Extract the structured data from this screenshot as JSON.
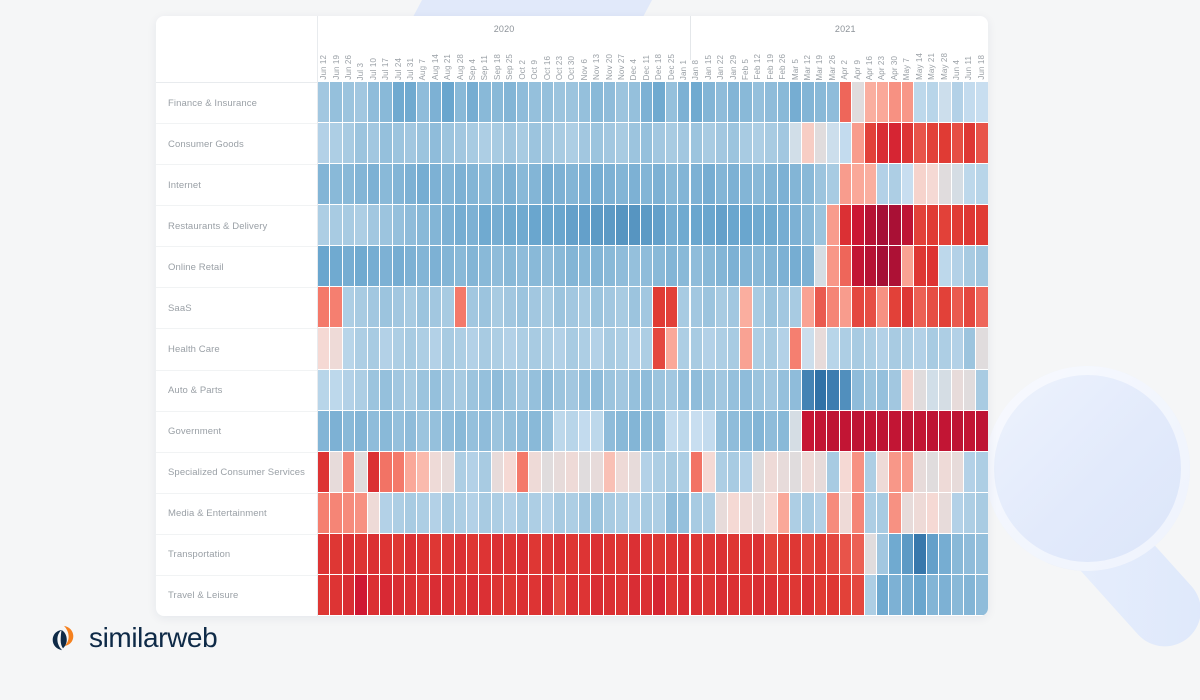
{
  "brand": {
    "name": "similarweb",
    "navy": "#0e2a47",
    "orange": "#f5811f"
  },
  "chart_data": {
    "type": "heatmap",
    "title": "",
    "xlabel": "",
    "ylabel": "",
    "legend_position": "none",
    "grid": false,
    "colorscale": {
      "name": "RdBu reversed (blue = below baseline / decline, red = above baseline / growth)",
      "stops": [
        {
          "value": -3,
          "color": "#2b6ca3"
        },
        {
          "value": -2,
          "color": "#6aa6ce"
        },
        {
          "value": -1,
          "color": "#a8cbe2"
        },
        {
          "value": -0.4,
          "color": "#c8def0"
        },
        {
          "value": 0,
          "color": "#d9dde0"
        },
        {
          "value": 0.4,
          "color": "#f5d9d4"
        },
        {
          "value": 1,
          "color": "#fbb4a5"
        },
        {
          "value": 2,
          "color": "#f4796a"
        },
        {
          "value": 3,
          "color": "#e03b34"
        },
        {
          "value": 4,
          "color": "#cf1733"
        },
        {
          "value": 5,
          "color": "#a50f35"
        }
      ]
    },
    "year_bands": [
      {
        "label": "2020",
        "start_index": 0,
        "end_index": 29
      },
      {
        "label": "2021",
        "start_index": 30,
        "end_index": 54
      }
    ],
    "x": [
      "Jun 12",
      "Jun 19",
      "Jun 26",
      "Jul 3",
      "Jul 10",
      "Jul 17",
      "Jul 24",
      "Jul 31",
      "Aug 7",
      "Aug 14",
      "Aug 21",
      "Aug 28",
      "Sep 4",
      "Sep 11",
      "Sep 18",
      "Sep 25",
      "Oct 2",
      "Oct 9",
      "Oct 16",
      "Oct 23",
      "Oct 30",
      "Nov 6",
      "Nov 13",
      "Nov 20",
      "Nov 27",
      "Dec 4",
      "Dec 11",
      "Dec 18",
      "Dec 25",
      "Jan 1",
      "Jan 8",
      "Jan 15",
      "Jan 22",
      "Jan 29",
      "Feb 5",
      "Feb 12",
      "Feb 19",
      "Feb 26",
      "Mar 5",
      "Mar 12",
      "Mar 19",
      "Mar 26",
      "Apr 2",
      "Apr 9",
      "Apr 16",
      "Apr 23",
      "Apr 30",
      "May 7",
      "May 14",
      "May 21",
      "May 28",
      "Jun 4",
      "Jun 11",
      "Jun 18"
    ],
    "y": [
      "Finance & Insurance",
      "Consumer Goods",
      "Internet",
      "Restaurants & Delivery",
      "Online Retail",
      "SaaS",
      "Health Care",
      "Auto & Parts",
      "Government",
      "Specialized Consumer Services",
      "Media & Entertainment",
      "Transportation",
      "Travel & Leisure"
    ],
    "series": [
      {
        "name": "Finance & Insurance",
        "values": [
          -1.1,
          -1.3,
          -1.2,
          -1.1,
          -1.4,
          -1.5,
          -1.9,
          -1.9,
          -1.4,
          -1.7,
          -2.0,
          -1.5,
          -1.8,
          -1.5,
          -1.5,
          -1.6,
          -1.4,
          -1.3,
          -1.3,
          -1.2,
          -1.2,
          -1.3,
          -1.5,
          -1.4,
          -1.2,
          -1.3,
          -1.7,
          -1.9,
          -1.3,
          -1.7,
          -1.9,
          -1.6,
          -1.4,
          -1.6,
          -1.5,
          -1.3,
          -1.4,
          -1.5,
          -1.8,
          -1.6,
          -1.5,
          -1.4,
          2.3,
          0.1,
          1.1,
          1.2,
          1.6,
          1.5,
          -0.6,
          -0.7,
          -0.3,
          -0.8,
          -0.5,
          -0.4
        ]
      },
      {
        "name": "Consumer Goods",
        "values": [
          -0.8,
          -0.9,
          -1.0,
          -1.2,
          -1.1,
          -1.3,
          -1.2,
          -1.1,
          -1.2,
          -1.4,
          -1.2,
          -1.1,
          -1.0,
          -0.9,
          -1.0,
          -1.1,
          -1.0,
          -1.2,
          -1.1,
          -1.0,
          -0.9,
          -1.1,
          -1.2,
          -1.1,
          -1.0,
          -1.2,
          -1.3,
          -1.1,
          -1.0,
          -1.1,
          -1.2,
          -1.0,
          -1.1,
          -1.2,
          -1.0,
          -0.9,
          -1.0,
          -1.1,
          -0.2,
          0.6,
          0.1,
          -0.3,
          -0.5,
          1.4,
          2.9,
          3.4,
          3.6,
          3.2,
          2.6,
          2.9,
          3.0,
          2.7,
          3.1,
          2.6
        ]
      },
      {
        "name": "Internet",
        "values": [
          -1.6,
          -1.5,
          -1.5,
          -1.6,
          -1.7,
          -1.5,
          -1.6,
          -1.7,
          -1.8,
          -1.7,
          -1.6,
          -1.7,
          -1.6,
          -1.5,
          -1.6,
          -1.7,
          -1.5,
          -1.6,
          -1.8,
          -1.7,
          -1.6,
          -1.7,
          -1.8,
          -1.7,
          -1.6,
          -1.7,
          -1.6,
          -1.7,
          -1.5,
          -1.6,
          -1.7,
          -1.8,
          -1.6,
          -1.7,
          -1.6,
          -1.5,
          -1.6,
          -1.7,
          -1.6,
          -1.5,
          -1.2,
          -1.0,
          1.4,
          1.2,
          1.1,
          -0.8,
          -0.9,
          -0.4,
          0.5,
          0.4,
          0.1,
          -0.1,
          -0.6,
          -0.7
        ]
      },
      {
        "name": "Restaurants & Delivery",
        "values": [
          -0.9,
          -1.0,
          -1.0,
          -0.9,
          -1.1,
          -1.2,
          -1.3,
          -1.4,
          -1.5,
          -1.6,
          -1.7,
          -1.8,
          -1.7,
          -1.9,
          -1.8,
          -1.9,
          -1.9,
          -2.0,
          -2.0,
          -2.0,
          -2.1,
          -2.1,
          -2.2,
          -2.2,
          -2.3,
          -2.3,
          -2.2,
          -2.1,
          -1.8,
          -1.9,
          -2.0,
          -2.0,
          -2.1,
          -2.0,
          -2.0,
          -1.9,
          -1.9,
          -1.8,
          -1.7,
          -1.5,
          -1.2,
          1.4,
          3.3,
          4.1,
          4.6,
          5.0,
          4.9,
          4.4,
          2.9,
          3.0,
          2.9,
          3.0,
          3.1,
          3.0
        ]
      },
      {
        "name": "Online Retail",
        "values": [
          -2.0,
          -1.9,
          -1.8,
          -1.9,
          -1.8,
          -1.7,
          -1.8,
          -1.7,
          -1.6,
          -1.7,
          -1.6,
          -1.5,
          -1.6,
          -1.5,
          -1.4,
          -1.5,
          -1.4,
          -1.5,
          -1.4,
          -1.5,
          -1.6,
          -1.5,
          -1.6,
          -1.5,
          -1.4,
          -1.3,
          -1.4,
          -1.5,
          -1.6,
          -1.5,
          -1.4,
          -1.5,
          -1.6,
          -1.7,
          -1.6,
          -1.5,
          -1.6,
          -1.7,
          -1.8,
          -1.7,
          -0.1,
          1.5,
          2.3,
          4.3,
          4.6,
          5.0,
          4.8,
          1.3,
          3.1,
          3.2,
          -0.6,
          -0.8,
          -1.0,
          -1.1
        ]
      },
      {
        "name": "SaaS",
        "values": [
          2.0,
          1.9,
          -0.9,
          -1.0,
          -1.1,
          -1.2,
          -1.1,
          -1.0,
          -1.2,
          -1.1,
          -1.0,
          2.0,
          -1.1,
          -1.2,
          -1.0,
          -1.1,
          -1.2,
          -1.1,
          -1.0,
          -1.2,
          -1.1,
          -1.0,
          -1.2,
          -1.1,
          -1.0,
          -1.2,
          -1.1,
          3.0,
          2.9,
          -1.0,
          -1.1,
          -1.2,
          -1.0,
          -1.1,
          1.1,
          -1.0,
          -1.2,
          -1.1,
          -1.0,
          1.3,
          2.5,
          1.8,
          1.4,
          2.8,
          2.7,
          1.6,
          2.9,
          3.1,
          2.4,
          2.7,
          2.9,
          2.5,
          2.8,
          2.3
        ]
      },
      {
        "name": "Health Care",
        "values": [
          0.4,
          0.3,
          -0.7,
          -0.9,
          -1.0,
          -0.8,
          -0.9,
          -1.0,
          -0.9,
          -0.8,
          -1.0,
          -0.9,
          -0.8,
          -1.0,
          -0.9,
          -0.8,
          -0.9,
          -1.0,
          -0.9,
          -0.8,
          -1.0,
          -0.9,
          -0.8,
          -1.0,
          -0.9,
          -0.8,
          -0.9,
          2.8,
          1.2,
          -0.9,
          -1.0,
          -0.8,
          -0.9,
          -1.0,
          1.3,
          -0.9,
          -1.0,
          -0.8,
          1.9,
          -0.3,
          0.2,
          -0.7,
          -0.9,
          -1.0,
          -0.9,
          -0.8,
          -1.0,
          -0.9,
          -0.8,
          -1.0,
          -0.9,
          -0.8,
          -1.2,
          0.1
        ]
      },
      {
        "name": "Auto & Parts",
        "values": [
          -0.7,
          -0.6,
          -0.8,
          -0.9,
          -1.2,
          -1.3,
          -1.1,
          -1.0,
          -1.2,
          -1.3,
          -1.1,
          -1.0,
          -1.2,
          -1.3,
          -1.4,
          -1.2,
          -1.1,
          -1.3,
          -1.4,
          -1.2,
          -1.1,
          -1.3,
          -1.4,
          -1.2,
          -1.1,
          -1.3,
          -1.4,
          -1.2,
          -1.1,
          -1.3,
          -1.4,
          -1.2,
          -1.1,
          -1.3,
          -1.4,
          -1.2,
          -1.1,
          -1.3,
          -1.4,
          -2.6,
          -2.9,
          -2.7,
          -2.4,
          -1.4,
          -1.2,
          -1.3,
          -1.1,
          0.5,
          0.1,
          -0.2,
          -0.1,
          0.2,
          0.1,
          -1.0
        ]
      },
      {
        "name": "Government",
        "values": [
          -1.6,
          -1.7,
          -1.5,
          -1.6,
          -1.4,
          -1.5,
          -1.3,
          -1.4,
          -1.2,
          -1.3,
          -1.4,
          -1.5,
          -1.3,
          -1.4,
          -1.2,
          -1.3,
          -1.4,
          -1.5,
          -1.3,
          -0.6,
          -0.7,
          -0.5,
          -0.6,
          -1.4,
          -1.5,
          -1.6,
          -1.5,
          -1.4,
          -0.5,
          -0.6,
          -0.4,
          -0.5,
          -1.3,
          -1.4,
          -1.5,
          -1.6,
          -1.4,
          -1.5,
          -0.1,
          4.2,
          4.3,
          4.4,
          4.3,
          4.4,
          4.3,
          4.4,
          4.3,
          4.4,
          4.3,
          4.4,
          4.3,
          4.4,
          4.3,
          4.4
        ]
      },
      {
        "name": "Specialized Consumer Services",
        "values": [
          3.2,
          0.2,
          1.8,
          0.1,
          3.3,
          2.1,
          2.0,
          1.2,
          0.9,
          0.3,
          0.2,
          -0.9,
          -0.8,
          -1.0,
          0.2,
          0.4,
          2.0,
          0.3,
          0.1,
          0.2,
          0.3,
          0.1,
          0.2,
          0.8,
          0.3,
          0.2,
          -0.8,
          -0.9,
          -1.0,
          -0.9,
          2.1,
          0.4,
          -0.9,
          -1.0,
          -0.8,
          0.1,
          0.3,
          0.2,
          0.1,
          0.3,
          0.2,
          -1.0,
          0.4,
          1.6,
          -0.9,
          0.3,
          1.5,
          1.4,
          0.2,
          0.1,
          0.3,
          0.2,
          -0.8,
          -0.9
        ]
      },
      {
        "name": "Media & Entertainment",
        "values": [
          1.9,
          1.8,
          1.7,
          1.6,
          0.3,
          -0.8,
          -0.9,
          -1.0,
          -0.9,
          -0.8,
          -1.0,
          -0.9,
          -0.8,
          -1.0,
          -0.9,
          -0.8,
          -1.0,
          -0.9,
          -0.8,
          -1.0,
          -0.9,
          -1.1,
          -1.2,
          -1.0,
          -0.9,
          -0.8,
          -1.0,
          -0.9,
          -1.4,
          -1.3,
          -1.0,
          -0.9,
          0.2,
          0.4,
          0.3,
          0.2,
          0.4,
          1.2,
          -0.9,
          -1.0,
          -0.8,
          1.7,
          0.3,
          1.8,
          -0.9,
          -1.0,
          1.6,
          0.2,
          0.3,
          0.4,
          0.2,
          -0.8,
          -0.9,
          -1.0
        ]
      },
      {
        "name": "Transportation",
        "values": [
          3.2,
          3.1,
          3.3,
          3.2,
          3.3,
          3.2,
          3.1,
          3.3,
          3.2,
          3.1,
          3.2,
          3.3,
          3.1,
          3.2,
          3.3,
          3.2,
          3.4,
          3.1,
          3.2,
          3.3,
          3.1,
          3.2,
          3.3,
          3.2,
          3.1,
          3.3,
          3.2,
          3.1,
          3.2,
          3.3,
          3.1,
          3.2,
          3.3,
          3.1,
          3.2,
          3.3,
          2.9,
          3.0,
          3.1,
          2.9,
          3.0,
          2.8,
          2.6,
          2.4,
          0.1,
          -1.1,
          -1.9,
          -2.2,
          -2.8,
          -2.1,
          -1.8,
          -1.5,
          -1.4,
          -1.3
        ]
      },
      {
        "name": "Travel & Leisure",
        "values": [
          3.1,
          3.2,
          3.4,
          4.0,
          3.3,
          3.5,
          3.4,
          3.3,
          3.2,
          3.4,
          3.3,
          3.2,
          3.4,
          3.3,
          3.2,
          3.1,
          3.3,
          3.2,
          3.4,
          2.8,
          3.3,
          3.2,
          3.4,
          3.3,
          3.2,
          3.4,
          3.3,
          3.6,
          3.2,
          3.4,
          3.3,
          3.2,
          3.4,
          3.3,
          3.2,
          3.4,
          3.3,
          3.2,
          3.1,
          3.3,
          3.0,
          3.1,
          2.9,
          2.8,
          -0.9,
          -1.9,
          -1.7,
          -1.8,
          -2.0,
          -1.6,
          -1.7,
          -1.5,
          -1.6,
          -1.4
        ]
      }
    ]
  }
}
